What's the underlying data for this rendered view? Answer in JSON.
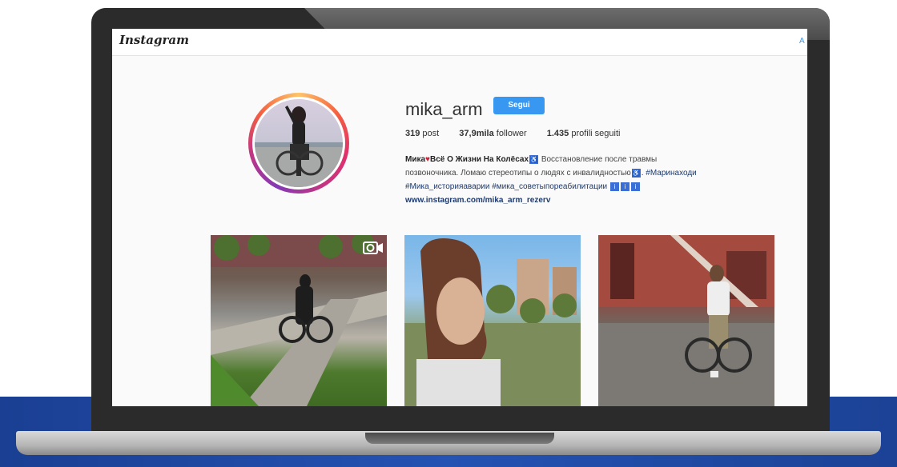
{
  "app": {
    "logo": "Instagram",
    "topbar_link": "A"
  },
  "profile": {
    "username": "mika_arm",
    "follow_button": "Segui",
    "stats": {
      "posts_count": "319",
      "posts_label": "post",
      "followers_count": "37,9mila",
      "followers_label": "follower",
      "following_count": "1.435",
      "following_label": "profili seguiti"
    },
    "bio": {
      "name": "Мика",
      "line1": "Всё О Жизни На Колёсах",
      "line1_tail": "Восстановление после травмы",
      "line2": "позвоночника. Ломаю стереотипы о людях с инвалидностью",
      "line2_tail": ". #Маринаходи",
      "line3": "#Мика_историяаварии #мика_советыпореабилитации",
      "link": "www.instagram.com/mika_arm_rezerv"
    }
  },
  "posts": [
    {
      "type": "video",
      "icon": "video-camera-icon"
    },
    {
      "type": "photo"
    },
    {
      "type": "photo"
    }
  ],
  "colors": {
    "accent": "#3897f0",
    "background_band": "#2553b3",
    "laptop_bezel": "#2b2b2b"
  }
}
